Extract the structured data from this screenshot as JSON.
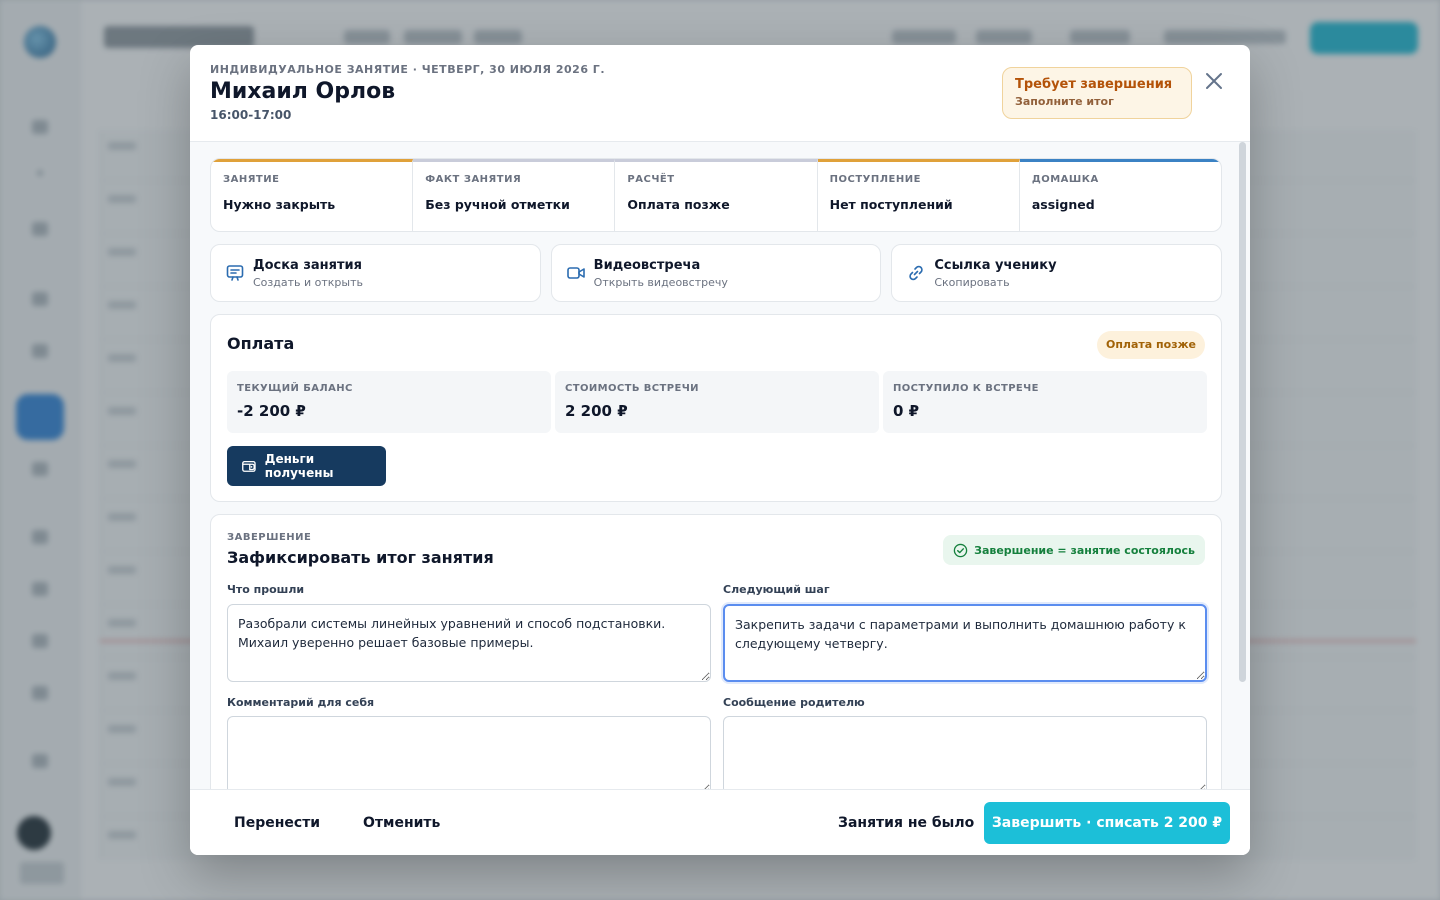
{
  "modal": {
    "eyebrow": "ИНДИВИДУАЛЬНОЕ ЗАНЯТИЕ · ЧЕТВЕРГ, 30 ИЮЛЯ 2026 Г.",
    "student_name": "Михаил Орлов",
    "time_range": "16:00-17:00",
    "alert_title": "Требует завершения",
    "alert_subtitle": "Заполните итог"
  },
  "status_strip": [
    {
      "label": "ЗАНЯТИЕ",
      "value": "Нужно закрыть",
      "color": "#e0a13a"
    },
    {
      "label": "ФАКТ ЗАНЯТИЯ",
      "value": "Без ручной отметки",
      "color": "#c9ccda"
    },
    {
      "label": "РАСЧЁТ",
      "value": "Оплата позже",
      "color": "#c9ccda"
    },
    {
      "label": "ПОСТУПЛЕНИЕ",
      "value": "Нет поступлений",
      "color": "#e0a13a"
    },
    {
      "label": "ДОМАШКА",
      "value": "assigned",
      "color": "#3b82c4"
    }
  ],
  "quick_actions": [
    {
      "title": "Доска занятия",
      "subtitle": "Создать и открыть",
      "icon": "board-icon"
    },
    {
      "title": "Видеовстреча",
      "subtitle": "Открыть видеовстречу",
      "icon": "video-icon"
    },
    {
      "title": "Ссылка ученику",
      "subtitle": "Скопировать",
      "icon": "link-icon"
    }
  ],
  "payment": {
    "title": "Оплата",
    "badge": "Оплата позже",
    "metrics": [
      {
        "label": "ТЕКУЩИЙ БАЛАНС",
        "value": "-2 200 ₽"
      },
      {
        "label": "СТОИМОСТЬ ВСТРЕЧИ",
        "value": "2 200 ₽"
      },
      {
        "label": "ПОСТУПИЛО К ВСТРЕЧЕ",
        "value": "0 ₽"
      }
    ],
    "money_button": "Деньги получены"
  },
  "completion": {
    "eyebrow": "ЗАВЕРШЕНИЕ",
    "title": "Зафиксировать итог занятия",
    "badge": "Завершение = занятие состоялось",
    "covered_label": "Что прошли",
    "covered_value": "Разобрали системы линейных уравнений и способ подстановки. Михаил уверенно решает базовые примеры.",
    "next_label": "Следующий шаг",
    "next_value": "Закрепить задачи с параметрами и выполнить домашнюю работу к следующему четвергу.",
    "self_comment_label": "Комментарий для себя",
    "self_comment_value": "",
    "parent_message_label": "Сообщение родителю",
    "parent_message_value": ""
  },
  "footer": {
    "reschedule": "Перенести",
    "cancel": "Отменить",
    "no_lesson": "Занятия не было",
    "finish": "Завершить · списать 2 200 ₽"
  },
  "colors": {
    "primary": "#1cbfd8",
    "dark_button": "#163a5f",
    "warning": "#b45309",
    "success": "#15803d"
  }
}
